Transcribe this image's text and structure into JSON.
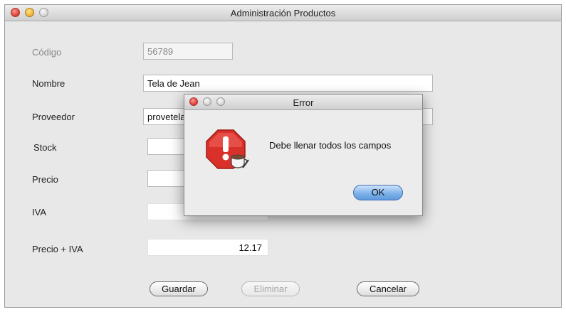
{
  "main_window": {
    "title": "Administración Productos",
    "fields": {
      "codigo": {
        "label": "Código",
        "value": "56789"
      },
      "nombre": {
        "label": "Nombre",
        "value": "Tela de Jean"
      },
      "proveedor": {
        "label": "Proveedor",
        "value": "provetela"
      },
      "stock": {
        "label": "Stock",
        "value": ""
      },
      "precio": {
        "label": "Precio",
        "value": ""
      },
      "iva": {
        "label": "IVA",
        "value": ""
      },
      "precio_iva": {
        "label": "Precio + IVA",
        "value": "12.17"
      }
    },
    "buttons": {
      "guardar": "Guardar",
      "eliminar": "Eliminar",
      "cancelar": "Cancelar"
    }
  },
  "error_dialog": {
    "title": "Error",
    "message": "Debe  llenar todos los campos",
    "ok_label": "OK",
    "icon": "stop-alert-icon"
  },
  "colors": {
    "window_bg": "#e8e8e8",
    "ok_button": "#7fb2ea",
    "alert_red": "#d9302a"
  }
}
